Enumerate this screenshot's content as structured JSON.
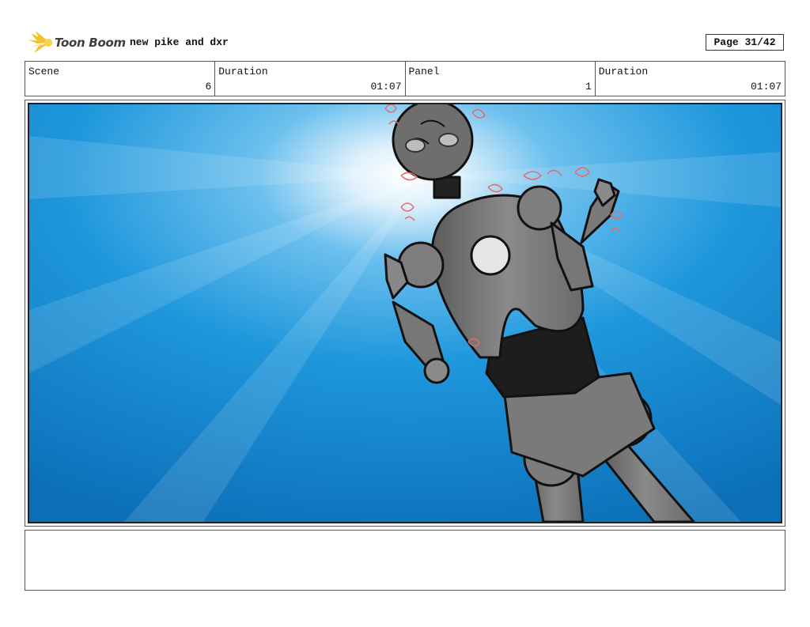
{
  "header": {
    "logo_text": "Toon Boom",
    "project_title": "new pike and dxr",
    "page_label": "Page 31/42"
  },
  "info": {
    "scene_label": "Scene",
    "scene_value": "6",
    "scene_duration_label": "Duration",
    "scene_duration_value": "01:07",
    "panel_label": "Panel",
    "panel_value": "1",
    "panel_duration_label": "Duration",
    "panel_duration_value": "01:07"
  },
  "panel": {
    "sky_color": "#1a8fd6",
    "robot_color": "#7a7a7a",
    "sketch_color": "#e86a6a"
  },
  "notes": {
    "text": ""
  }
}
